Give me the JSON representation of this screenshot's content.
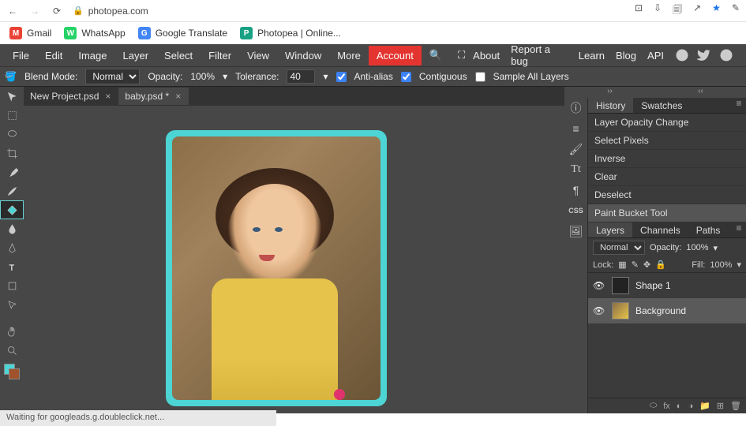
{
  "browser": {
    "url": "photopea.com",
    "bookmarks": [
      {
        "label": "Gmail",
        "color": "#ea4335",
        "ico": "M"
      },
      {
        "label": "WhatsApp",
        "color": "#25d366",
        "ico": "W"
      },
      {
        "label": "Google Translate",
        "color": "#4285f4",
        "ico": "G"
      },
      {
        "label": "Photopea | Online...",
        "color": "#18a184",
        "ico": "P"
      }
    ]
  },
  "menu": [
    "File",
    "Edit",
    "Image",
    "Layer",
    "Select",
    "Filter",
    "View",
    "Window",
    "More"
  ],
  "menu_account": "Account",
  "menu_right": [
    "About",
    "Report a bug",
    "Learn",
    "Blog",
    "API"
  ],
  "options": {
    "blend_label": "Blend Mode:",
    "blend_value": "Normal",
    "opacity_label": "Opacity:",
    "opacity_value": "100%",
    "tolerance_label": "Tolerance:",
    "tolerance_value": "40",
    "antialias": "Anti-alias",
    "contiguous": "Contiguous",
    "sample_all": "Sample All Layers"
  },
  "tabs": [
    {
      "label": "New Project.psd"
    },
    {
      "label": "baby.psd *"
    }
  ],
  "history": {
    "tabs": [
      "History",
      "Swatches"
    ],
    "items": [
      "Layer Opacity Change",
      "Select Pixels",
      "Inverse",
      "Clear",
      "Deselect",
      "Paint Bucket Tool"
    ]
  },
  "layers": {
    "tabs": [
      "Layers",
      "Channels",
      "Paths"
    ],
    "mode": "Normal",
    "opacity_label": "Opacity:",
    "opacity": "100%",
    "lock_label": "Lock:",
    "fill_label": "Fill:",
    "fill": "100%",
    "items": [
      {
        "name": "Shape 1"
      },
      {
        "name": "Background"
      }
    ]
  },
  "status": "Waiting for googleads.g.doubleclick.net..."
}
